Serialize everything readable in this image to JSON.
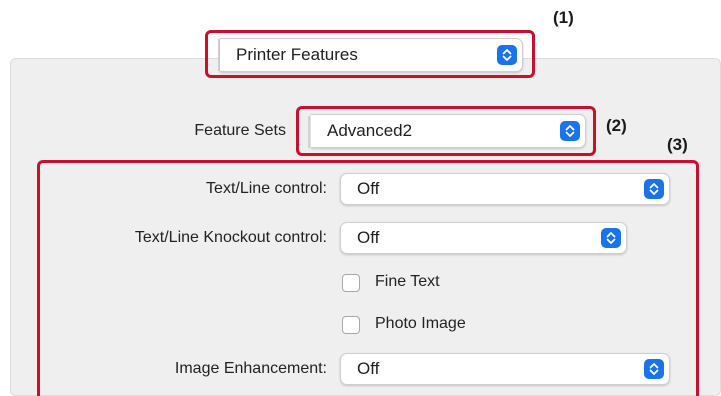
{
  "callouts": [
    "(1)",
    "(2)",
    "(3)"
  ],
  "top_popup": {
    "value": "Printer Features",
    "icon": "chevron-updown-icon"
  },
  "feature_sets": {
    "label": "Feature Sets",
    "value": "Advanced2",
    "icon": "chevron-updown-icon"
  },
  "options": {
    "text_line_control": {
      "label": "Text/Line control:",
      "value": "Off"
    },
    "knockout_control": {
      "label": "Text/Line Knockout control:",
      "value": "Off"
    },
    "fine_text": {
      "label": "Fine Text",
      "checked": false
    },
    "photo_image": {
      "label": "Photo Image",
      "checked": false
    },
    "image_enhancement": {
      "label": "Image Enhancement:",
      "value": "Off"
    }
  },
  "colors": {
    "callout": "#c8102e",
    "accent": "#1a73e8",
    "panel": "#efefef"
  }
}
